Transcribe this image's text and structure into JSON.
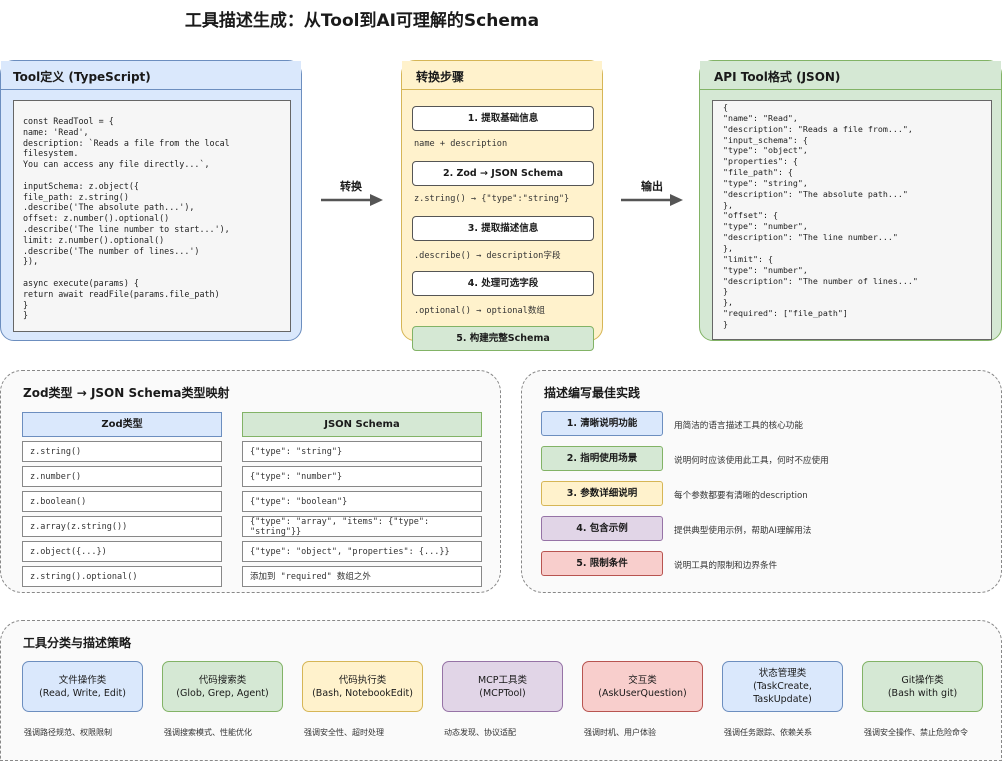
{
  "title": "工具描述生成：从Tool到AI可理解的Schema",
  "tool_def": {
    "heading": "Tool定义 (TypeScript)",
    "code": "const ReadTool = {\nname: 'Read',\ndescription: `Reads a file from the local\nfilesystem.\nYou can access any file directly...`,\n\ninputSchema: z.object({\nfile_path: z.string()\n.describe('The absolute path...'),\noffset: z.number().optional()\n.describe('The line number to start...'),\nlimit: z.number().optional()\n.describe('The number of lines...')\n}),\n\nasync execute(params) {\nreturn await readFile(params.file_path)\n}\n}"
  },
  "arrows": {
    "convert": "转换",
    "output": "输出"
  },
  "steps": {
    "heading": "转换步骤",
    "items": [
      {
        "label": "1. 提取基础信息",
        "note": "name + description"
      },
      {
        "label": "2. Zod → JSON Schema",
        "note": "z.string() → {\"type\":\"string\"}"
      },
      {
        "label": "3. 提取描述信息",
        "note": ".describe() → description字段"
      },
      {
        "label": "4. 处理可选字段",
        "note": ".optional() → optional数组"
      },
      {
        "label": "5. 构建完整Schema",
        "note": ""
      }
    ]
  },
  "api_json": {
    "heading": "API Tool格式 (JSON)",
    "code": "{\n\"name\": \"Read\",\n\"description\": \"Reads a file from...\",\n\"input_schema\": {\n\"type\": \"object\",\n\"properties\": {\n\"file_path\": {\n\"type\": \"string\",\n\"description\": \"The absolute path...\"\n},\n\"offset\": {\n\"type\": \"number\",\n\"description\": \"The line number...\"\n},\n\"limit\": {\n\"type\": \"number\",\n\"description\": \"The number of lines...\"\n}\n},\n\"required\": [\"file_path\"]\n}"
  },
  "mapping": {
    "heading": "Zod类型 → JSON Schema类型映射",
    "col_zod": "Zod类型",
    "col_json": "JSON Schema",
    "rows": [
      {
        "zod": "z.string()",
        "json": "{\"type\": \"string\"}"
      },
      {
        "zod": "z.number()",
        "json": "{\"type\": \"number\"}"
      },
      {
        "zod": "z.boolean()",
        "json": "{\"type\": \"boolean\"}"
      },
      {
        "zod": "z.array(z.string())",
        "json": "{\"type\": \"array\", \"items\": {\"type\":\n\"string\"}}"
      },
      {
        "zod": "z.object({...})",
        "json": "{\"type\": \"object\", \"properties\": {...}}"
      },
      {
        "zod": "z.string().optional()",
        "json": "添加到 \"required\" 数组之外"
      }
    ]
  },
  "practices": {
    "heading": "描述编写最佳实践",
    "items": [
      {
        "label": "1. 清晰说明功能",
        "text": "用简洁的语言描述工具的核心功能",
        "bg": "#dae8fc",
        "border": "#6c8ebf"
      },
      {
        "label": "2. 指明使用场景",
        "text": "说明何时应该使用此工具，何时不应使用",
        "bg": "#d5e8d4",
        "border": "#82b366"
      },
      {
        "label": "3. 参数详细说明",
        "text": "每个参数都要有清晰的description",
        "bg": "#fff2cc",
        "border": "#d6b656"
      },
      {
        "label": "4. 包含示例",
        "text": "提供典型使用示例，帮助AI理解用法",
        "bg": "#e1d5e7",
        "border": "#9673a6"
      },
      {
        "label": "5. 限制条件",
        "text": "说明工具的限制和边界条件",
        "bg": "#f8cecc",
        "border": "#b85450"
      }
    ]
  },
  "categories": {
    "heading": "工具分类与描述策略",
    "items": [
      {
        "name": "文件操作类",
        "tools": "(Read, Write, Edit)",
        "note": "强调路径规范、权限限制",
        "bg": "#dae8fc",
        "border": "#6c8ebf"
      },
      {
        "name": "代码搜索类",
        "tools": "(Glob, Grep, Agent)",
        "note": "强调搜索模式、性能优化",
        "bg": "#d5e8d4",
        "border": "#82b366"
      },
      {
        "name": "代码执行类",
        "tools": "(Bash, NotebookEdit)",
        "note": "强调安全性、超时处理",
        "bg": "#fff2cc",
        "border": "#d6b656"
      },
      {
        "name": "MCP工具类",
        "tools": "(MCPTool)",
        "note": "动态发现、协议适配",
        "bg": "#e1d5e7",
        "border": "#9673a6"
      },
      {
        "name": "交互类",
        "tools": "(AskUserQuestion)",
        "note": "强调时机、用户体验",
        "bg": "#f8cecc",
        "border": "#b85450"
      },
      {
        "name": "状态管理类",
        "tools": "(TaskCreate, TaskUpdate)",
        "note": "强调任务跟踪、依赖关系",
        "bg": "#dae8fc",
        "border": "#6c8ebf"
      },
      {
        "name": "Git操作类",
        "tools": "(Bash with git)",
        "note": "强调安全操作、禁止危险命令",
        "bg": "#d5e8d4",
        "border": "#82b366"
      }
    ]
  }
}
